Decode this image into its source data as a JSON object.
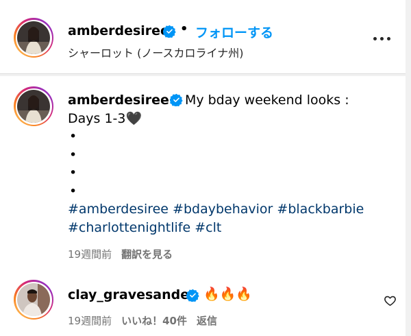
{
  "header": {
    "username": "amberdesiree",
    "separator": "•",
    "follow_label": "フォローする",
    "location": "シャーロット (ノースカロライナ州)",
    "more_icon": "more-options-icon"
  },
  "caption": {
    "username": "amberdesiree",
    "text_line1": "My bday weekend looks :",
    "text_line2": "Days 1-3🖤",
    "bullets": [
      "•",
      "•",
      "•",
      "•"
    ],
    "hashtags_line1": [
      "#amberdesiree",
      "#bdaybehavior",
      "#blackbarbie"
    ],
    "hashtags_line2": [
      "#charlottenightlife",
      "#clt"
    ],
    "time": "19週間前",
    "translate_label": "翻訳を見る"
  },
  "comment": {
    "username": "clay_gravesande",
    "text": "🔥🔥🔥",
    "time": "19週間前",
    "likes_label": "いいね！40件",
    "reply_label": "返信"
  },
  "colors": {
    "link_blue": "#0095f6",
    "hashtag_blue": "#00376b",
    "verified_blue": "#0095f6",
    "muted_text": "#737373"
  }
}
